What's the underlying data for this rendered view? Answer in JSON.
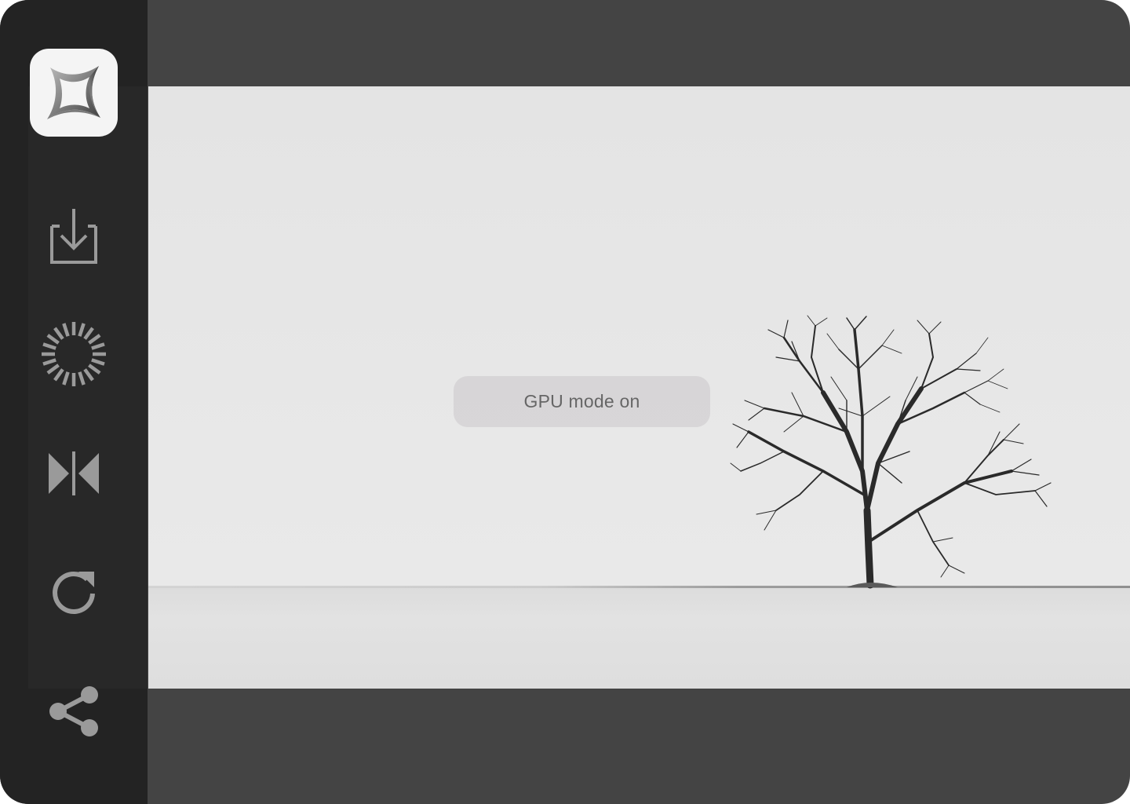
{
  "app": {
    "logo_icon": "app-logo-icon"
  },
  "sidebar": {
    "tools": [
      {
        "name": "import",
        "icon": "import-icon"
      },
      {
        "name": "processing",
        "icon": "spinner-icon"
      },
      {
        "name": "compare",
        "icon": "compare-icon"
      },
      {
        "name": "reset",
        "icon": "refresh-icon"
      },
      {
        "name": "share",
        "icon": "share-icon"
      }
    ]
  },
  "canvas": {
    "image_subject": "lone-tree-in-snow-field",
    "toast": {
      "text": "GPU mode on"
    }
  },
  "colors": {
    "window_bg": "#444444",
    "sidebar_bg": "#232323",
    "icon_color": "#9a9a9a",
    "toast_bg": "#d6d4d6",
    "toast_text": "#666666"
  }
}
